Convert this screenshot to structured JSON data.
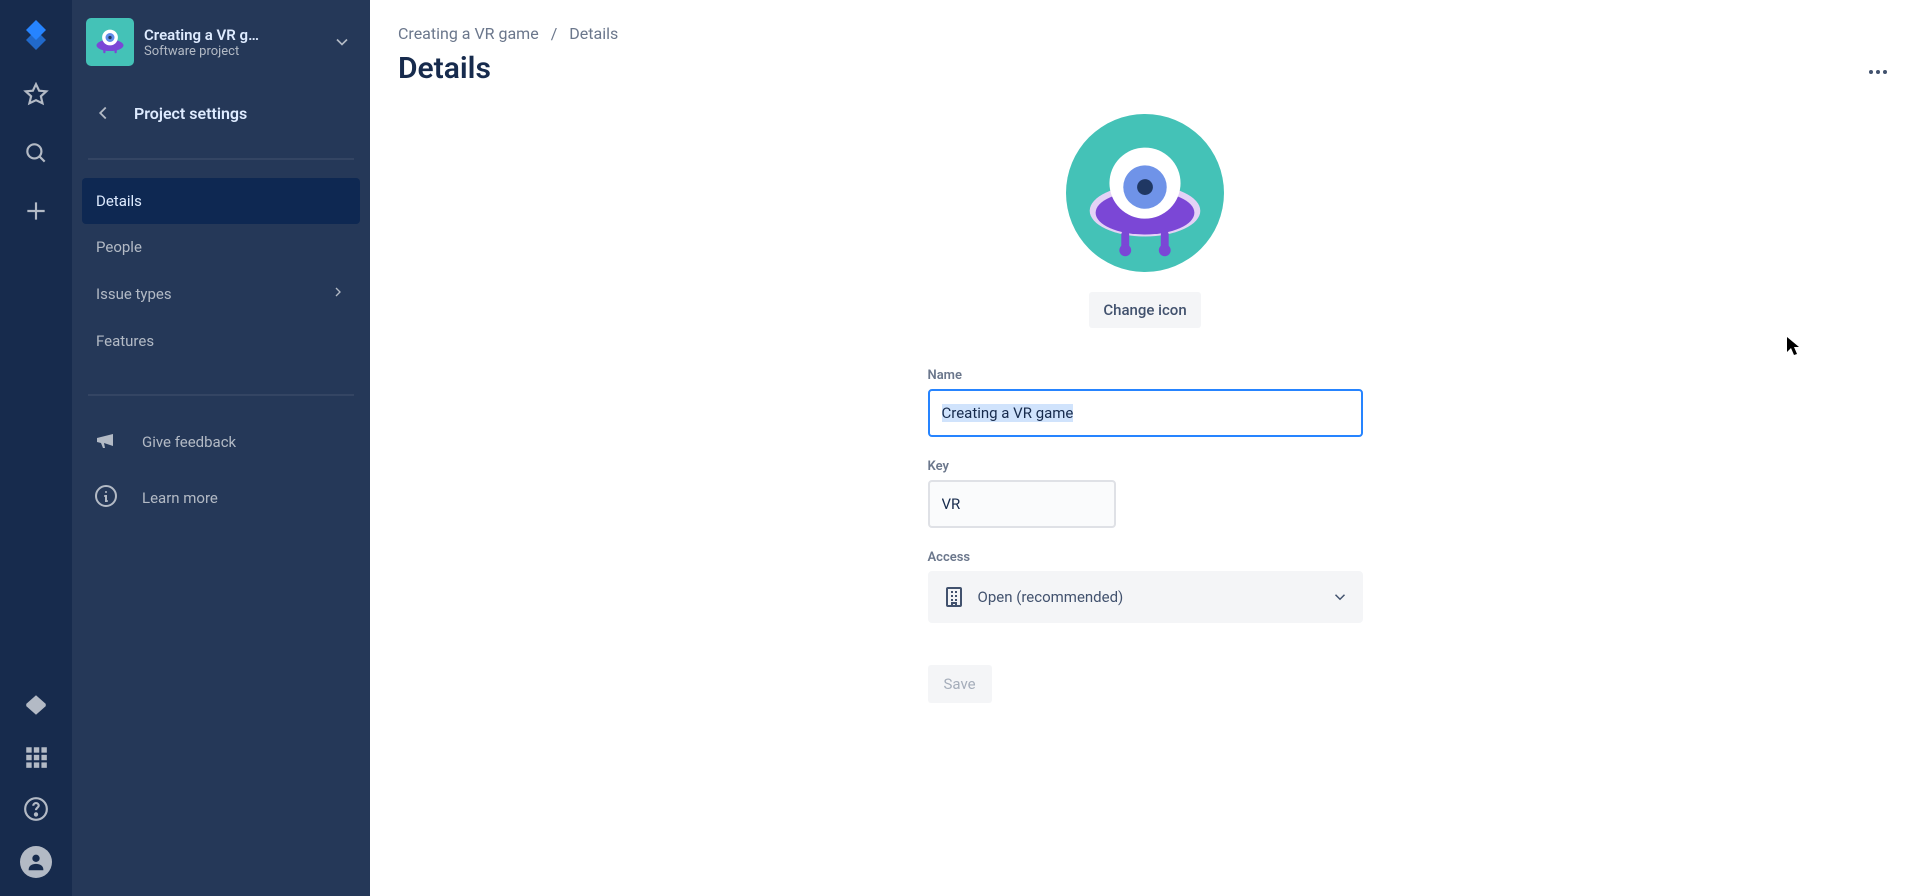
{
  "rail": {},
  "sidebar": {
    "project_name": "Creating a VR g…",
    "project_type": "Software project",
    "settings_back": "Project settings",
    "nav": {
      "details": "Details",
      "people": "People",
      "issue_types": "Issue types",
      "features": "Features"
    },
    "extras": {
      "feedback": "Give feedback",
      "learn": "Learn more"
    }
  },
  "breadcrumbs": {
    "project": "Creating a VR game",
    "current": "Details"
  },
  "page": {
    "title": "Details",
    "change_icon": "Change icon",
    "name_label": "Name",
    "name_value": "Creating a VR game",
    "key_label": "Key",
    "key_value": "VR",
    "access_label": "Access",
    "access_value": "Open (recommended)",
    "save": "Save"
  }
}
